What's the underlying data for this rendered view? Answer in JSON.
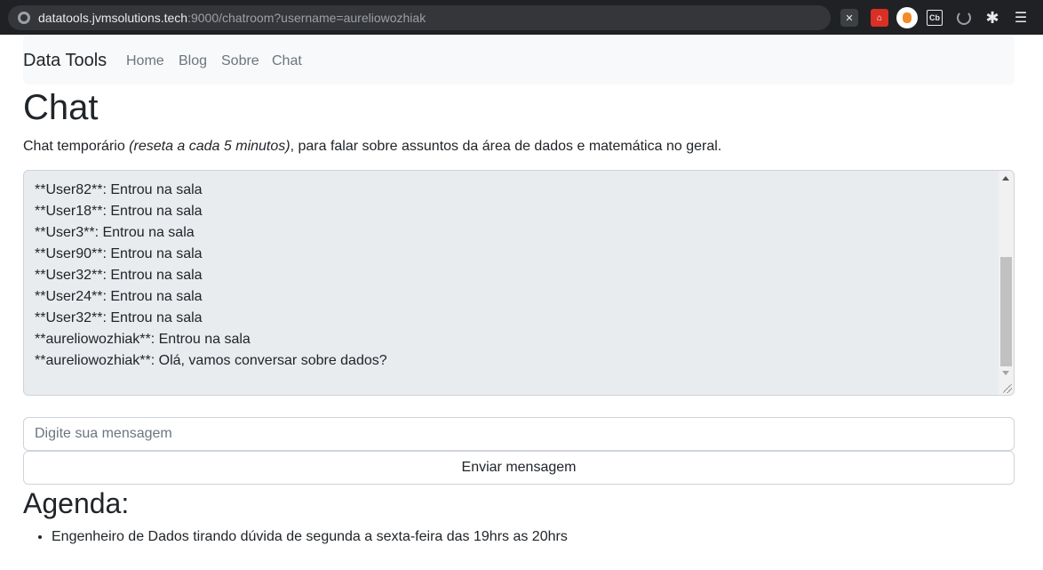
{
  "browser": {
    "url_host": "datatools.jvmsolutions.tech",
    "url_rest": ":9000/chatroom?username=aureliowozhiak",
    "extensions": [
      "x-extension-icon",
      "pdf-extension-icon",
      "orange-extension-icon",
      "cb-extension-icon",
      "ring-extension-icon",
      "puzzle-icon",
      "reading-list-icon"
    ]
  },
  "navbar": {
    "brand": "Data Tools",
    "links": [
      "Home",
      "Blog",
      "Sobre",
      "Chat"
    ]
  },
  "page": {
    "title": "Chat",
    "intro_before": "Chat temporário ",
    "intro_em": "(reseta a cada 5 minutos)",
    "intro_after": ", para falar sobre assuntos da área de dados e matemática no geral."
  },
  "chat": {
    "lines": [
      "**User82**: Entrou na sala",
      "**User18**: Entrou na sala",
      "**User3**: Entrou na sala",
      "**User90**: Entrou na sala",
      "**User32**: Entrou na sala",
      "**User24**: Entrou na sala",
      "**User32**: Entrou na sala",
      "**aureliowozhiak**: Entrou na sala",
      "**aureliowozhiak**: Olá, vamos conversar sobre dados?"
    ],
    "input_placeholder": "Digite sua mensagem",
    "input_value": "",
    "send_label": "Enviar mensagem"
  },
  "agenda": {
    "title": "Agenda:",
    "items": [
      "Engenheiro de Dados tirando dúvida de segunda a sexta-feira das 19hrs as 20hrs"
    ]
  }
}
